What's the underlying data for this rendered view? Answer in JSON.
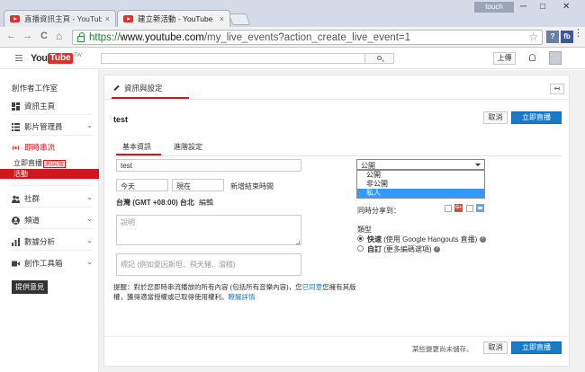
{
  "browser": {
    "tabs": [
      {
        "title": "直播資訊主頁 - YouTube",
        "close": "×"
      },
      {
        "title": "建立新活動 - YouTube",
        "close": "×"
      }
    ],
    "profile": "touch",
    "window_controls": {
      "minimize": "─",
      "maximize": "□",
      "close": "✕"
    },
    "nav": {
      "back": "←",
      "forward": "→",
      "reload": "C",
      "home": "⌂"
    },
    "url": {
      "scheme": "https://",
      "host": "www.youtube.com",
      "path": "/my_live_events?action_create_live_event=1"
    },
    "star": "☆",
    "extensions": [
      {
        "label": "?",
        "color": "#6b7fa3"
      },
      {
        "label": "fb",
        "color": "#3b5998"
      }
    ]
  },
  "youtube_header": {
    "logo_you": "You",
    "logo_tube": "Tube",
    "logo_country": "TW",
    "search_placeholder": "",
    "upload_label": "上傳"
  },
  "sidebar": {
    "title": "創作者工作室",
    "items": [
      {
        "label": "資訊主頁"
      },
      {
        "label": "影片管理員"
      },
      {
        "label": "即時串流"
      },
      {
        "label": "社群"
      },
      {
        "label": "頻道"
      },
      {
        "label": "數據分析"
      },
      {
        "label": "創作工具箱"
      }
    ],
    "live_sub": {
      "go_live": "立即直播",
      "beta": "測試版",
      "events": "活動"
    },
    "feedback": "提供意見"
  },
  "main": {
    "tab_label": "資訊與設定",
    "back_icon": "↤",
    "event_title": "test",
    "cancel": "取消",
    "go_live": "立即直播",
    "subtabs": {
      "basic": "基本資訊",
      "advanced": "進階設定"
    },
    "form": {
      "title_value": "test",
      "date_value": "今天",
      "time_value": "現在",
      "add_end_time": "新增結束時間",
      "timezone": "台灣 (GMT +08:00) 台北",
      "edit": "編輯",
      "description_placeholder": "說明",
      "tags_placeholder": "標記 (例如愛因斯坦、飛天豬、滑稽)"
    },
    "privacy": {
      "selected": "公開",
      "options": [
        "公開",
        "非公開",
        "私人"
      ],
      "highlighted": 2
    },
    "share_label": "同時分享到：",
    "share_gplus": "G+",
    "type": {
      "label": "類型",
      "quick_label": "快速",
      "quick_desc": "(使用 Google Hangouts 直播)",
      "custom_label": "自訂",
      "custom_desc": "(更多編碼選項)",
      "help": "?"
    },
    "notice": {
      "part1": "提醒：對於您即時串流播放的所有內容 (包括所有音樂內容)，您",
      "link1": "已同意",
      "part2": "您擁有其版權，獲得適當授權或已取得使用權利。",
      "link2": "瞭解詳情"
    },
    "footer": {
      "unsaved": "某些變更尚未儲存。",
      "cancel": "取消",
      "go_live": "立即直播"
    }
  }
}
